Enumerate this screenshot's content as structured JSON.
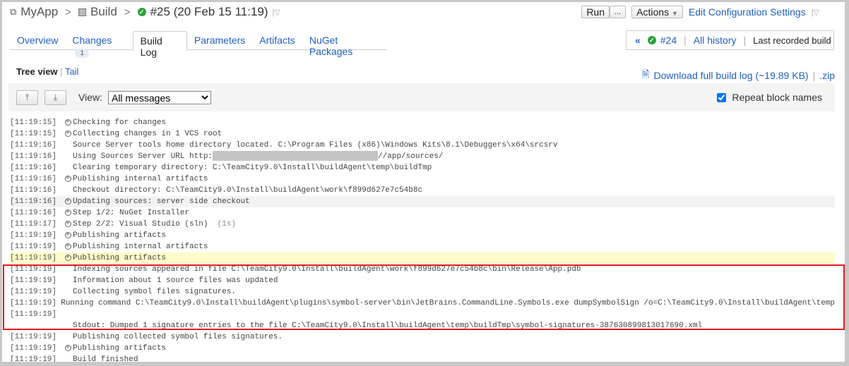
{
  "breadcrumb": {
    "project": "MyApp",
    "config": "Build",
    "build": "#25 (20 Feb 15 11:19)"
  },
  "header": {
    "run": "Run",
    "more": "...",
    "actions": "Actions",
    "edit": "Edit Configuration Settings"
  },
  "tabs": [
    {
      "label": "Overview"
    },
    {
      "label": "Changes",
      "badge": "1"
    },
    {
      "label": "Build Log",
      "active": true
    },
    {
      "label": "Parameters"
    },
    {
      "label": "Artifacts"
    },
    {
      "label": "NuGet Packages"
    }
  ],
  "history": {
    "prev": "#24",
    "all": "All history",
    "last": "Last recorded build"
  },
  "subtabs": {
    "tree": "Tree view",
    "tail": "Tail"
  },
  "download": {
    "label": "Download full build log (~19.89 KB)",
    "zip": ".zip"
  },
  "toolbar": {
    "view_label": "View:",
    "view_value": "All messages",
    "repeat": "Repeat block names",
    "repeat_checked": true
  },
  "colors": {
    "accent": "#1d5fbf",
    "success": "#2aa13a",
    "highlight": "#e41c1c"
  },
  "log": [
    {
      "ts": "[11:19:15]",
      "exp": true,
      "text": "Checking for changes"
    },
    {
      "ts": "[11:19:15]",
      "exp": true,
      "text": "Collecting changes in 1 VCS root"
    },
    {
      "ts": "[11:19:16]",
      "exp": false,
      "text": "Source Server tools home directory located. C:\\Program Files (x86)\\Windows Kits\\8.1\\Debuggers\\x64\\srcsrv"
    },
    {
      "ts": "[11:19:16]",
      "exp": false,
      "text": "Using Sources Server URL http:",
      "masked": true,
      "after": "//app/sources/"
    },
    {
      "ts": "[11:19:16]",
      "exp": false,
      "text": "Clearing temporary directory: C:\\TeamCity9.0\\Install\\buildAgent\\temp\\buildTmp"
    },
    {
      "ts": "[11:19:16]",
      "exp": true,
      "text": "Publishing internal artifacts"
    },
    {
      "ts": "[11:19:16]",
      "exp": false,
      "text": "Checkout directory: C:\\TeamCity9.0\\Install\\buildAgent\\work\\f899d627e7c54b8c"
    },
    {
      "ts": "[11:19:16]",
      "exp": true,
      "text": "Updating sources: server side checkout",
      "style": "grey"
    },
    {
      "ts": "[11:19:16]",
      "exp": true,
      "text": "Step 1/2: NuGet Installer"
    },
    {
      "ts": "[11:19:17]",
      "exp": true,
      "text": "Step 2/2: Visual Studio (sln)",
      "dur": "(1s)"
    },
    {
      "ts": "[11:19:19]",
      "exp": true,
      "text": "Publishing artifacts"
    },
    {
      "ts": "[11:19:19]",
      "exp": true,
      "text": "Publishing internal artifacts"
    },
    {
      "ts": "[11:19:19]",
      "exp": true,
      "text": "Publishing artifacts",
      "style": "yellow"
    },
    {
      "ts": "[11:19:19]",
      "exp": false,
      "text": "Indexing sources appeared in file C:\\TeamCity9.0\\Install\\buildAgent\\work\\f899d627e7c54b8c\\bin\\Release\\App.pdb"
    },
    {
      "ts": "[11:19:19]",
      "exp": false,
      "text": "Information about 1 source files was updated"
    },
    {
      "ts": "[11:19:19]",
      "exp": false,
      "text": "Collecting symbol files signatures."
    },
    {
      "ts": "[11:19:19]",
      "exp": false,
      "text": "Running command C:\\TeamCity9.0\\Install\\buildAgent\\plugins\\symbol-server\\bin\\JetBrains.CommandLine.Symbols.exe dumpSymbolSign /o=C:\\TeamCity9.0\\Install\\buildAgent\\temp"
    },
    {
      "ts": "[11:19:19]",
      "exp": false,
      "text": ""
    },
    {
      "ts": "",
      "exp": false,
      "text": "Stdout: Dumped 1 signature entries to the file C:\\TeamCity9.0\\Install\\buildAgent\\temp\\buildTmp\\symbol-signatures-387630899813017690.xml"
    },
    {
      "ts": "[11:19:19]",
      "exp": false,
      "text": "Publishing collected symbol files signatures."
    },
    {
      "ts": "[11:19:19]",
      "exp": true,
      "text": "Publishing artifacts"
    },
    {
      "ts": "[11:19:19]",
      "exp": false,
      "text": "Build finished"
    }
  ]
}
